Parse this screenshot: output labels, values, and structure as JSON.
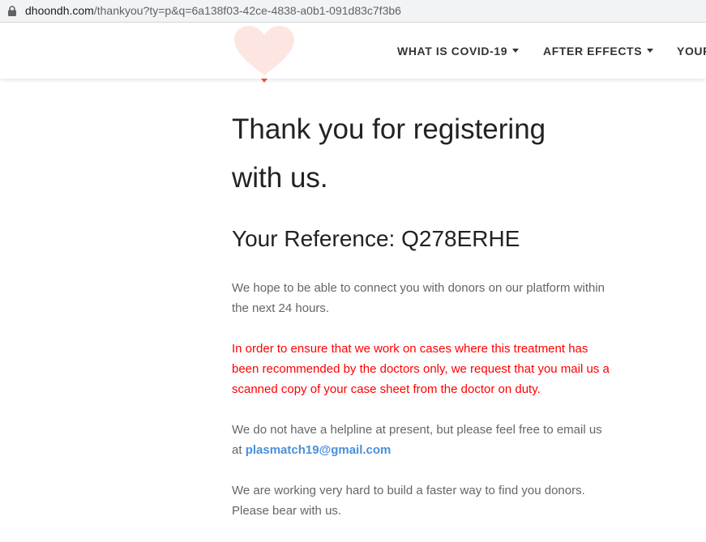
{
  "browser": {
    "url_host": "dhoondh.com",
    "url_path": "/thankyou?ty=p&q=6a138f03-42ce-4838-a0b1-091d83c7f3b6"
  },
  "nav": {
    "items": [
      {
        "label": "WHAT IS COVID-19"
      },
      {
        "label": "AFTER EFFECTS"
      },
      {
        "label": "YOUR"
      }
    ]
  },
  "main": {
    "title_line1": "Thank you for registering",
    "title_line2": "with us.",
    "reference": "Your Reference: Q278ERHE",
    "intro": "We hope to be able to connect you with donors on our platform within the next 24 hours.",
    "warning": "In order to ensure that we work on cases where this treatment has been recommended by the doctors only, we request that you mail us a scanned copy of your case sheet from the doctor on duty.",
    "helpline_text": "We do not have a helpline at present, but please feel free to email us at ",
    "email": "plasmatch19@gmail.com",
    "closing": "We are working very hard to build a faster way to find you donors. Please bear with us."
  },
  "colors": {
    "warning": "#ff0000",
    "link": "#4a90d9",
    "logo_heart": "#fde6e2",
    "logo_accent": "#e8503a"
  },
  "icons": [
    "lock-icon",
    "heart-logo-icon",
    "dropdown-caret-icon"
  ]
}
